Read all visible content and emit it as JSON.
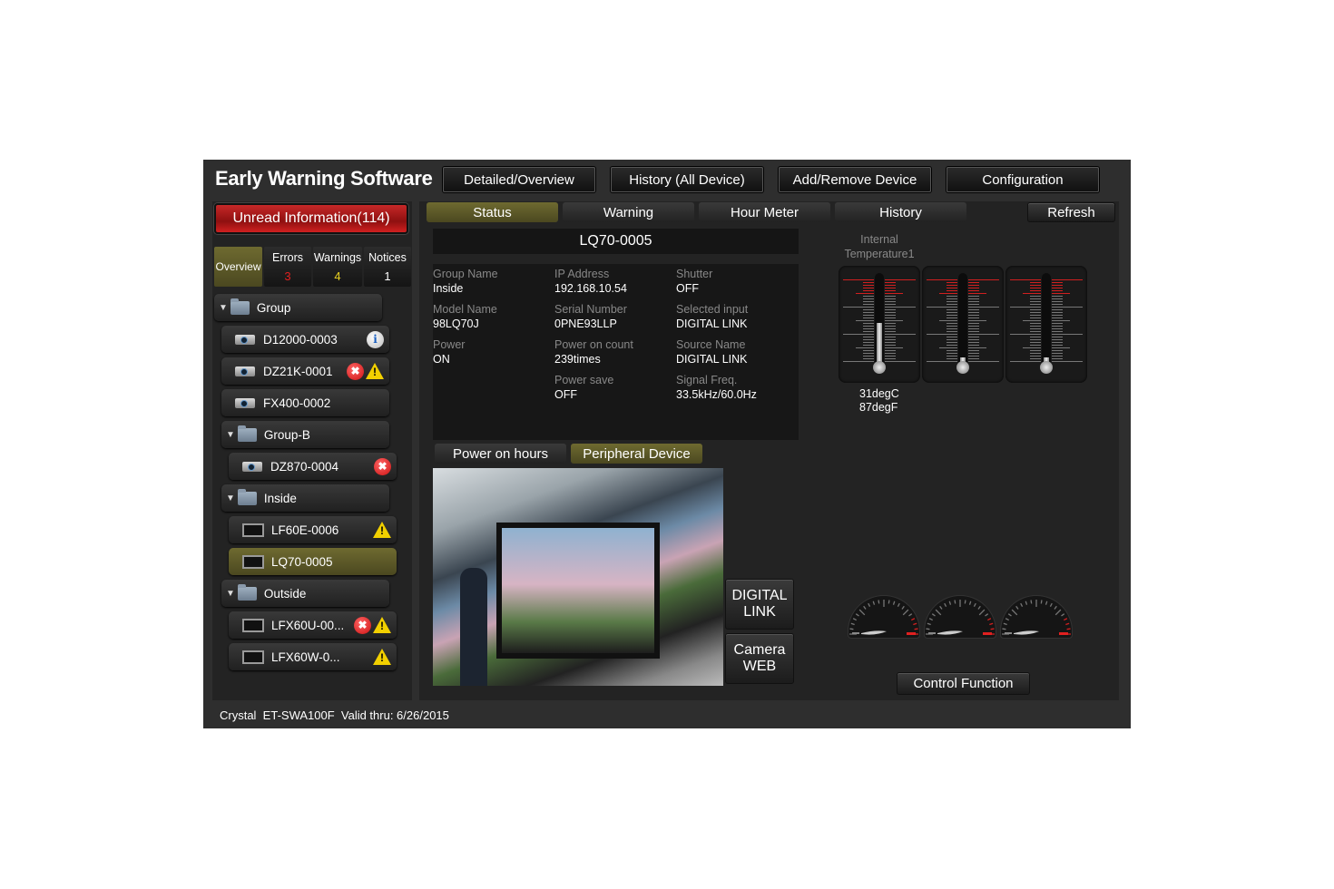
{
  "app": {
    "title": "Early Warning Software",
    "nav": [
      "Detailed/Overview",
      "History (All Device)",
      "Add/Remove Device",
      "Configuration"
    ],
    "footer": "Crystal  ET-SWA100F  Valid thru: 6/26/2015"
  },
  "sidebar": {
    "unread": "Unread Information(114)",
    "filters": [
      {
        "label": "Overview",
        "count": ""
      },
      {
        "label": "Errors",
        "count": "3",
        "color": "#e02020"
      },
      {
        "label": "Warnings",
        "count": "4",
        "color": "#e8d020"
      },
      {
        "label": "Notices",
        "count": "1",
        "color": "#ffffff"
      }
    ],
    "tree": [
      {
        "label": "Group",
        "type": "folder",
        "level": 0
      },
      {
        "label": "D12000-0003",
        "type": "projector",
        "level": 1,
        "icons": [
          "info"
        ]
      },
      {
        "label": "DZ21K-0001",
        "type": "projector",
        "level": 1,
        "icons": [
          "error",
          "warning"
        ]
      },
      {
        "label": "FX400-0002",
        "type": "projector",
        "level": 1,
        "icons": []
      },
      {
        "label": "Group-B",
        "type": "folder",
        "level": 1
      },
      {
        "label": "DZ870-0004",
        "type": "projector",
        "level": 2,
        "icons": [
          "error"
        ]
      },
      {
        "label": "Inside",
        "type": "folder",
        "level": 1
      },
      {
        "label": "LF60E-0006",
        "type": "display",
        "level": 2,
        "icons": [
          "warning"
        ]
      },
      {
        "label": "LQ70-0005",
        "type": "display",
        "level": 2,
        "icons": [],
        "selected": true
      },
      {
        "label": "Outside",
        "type": "folder",
        "level": 1
      },
      {
        "label": "LFX60U-00...",
        "type": "display",
        "level": 2,
        "icons": [
          "error",
          "warning"
        ]
      },
      {
        "label": "LFX60W-0...",
        "type": "display",
        "level": 2,
        "icons": [
          "warning"
        ]
      }
    ]
  },
  "main": {
    "tabs": [
      "Status",
      "Warning",
      "Hour Meter",
      "History"
    ],
    "active_tab": "Status",
    "refresh": "Refresh",
    "device": "LQ70-0005",
    "fields": [
      {
        "label": "Group Name",
        "value": "Inside"
      },
      {
        "label": "IP Address",
        "value": "192.168.10.54"
      },
      {
        "label": "Shutter",
        "value": "OFF"
      },
      {
        "label": "Model Name",
        "value": "98LQ70J"
      },
      {
        "label": "Serial Number",
        "value": "0PNE93LLP"
      },
      {
        "label": "Selected input",
        "value": "DIGITAL LINK"
      },
      {
        "label": "Power",
        "value": "ON"
      },
      {
        "label": "Power on count",
        "value": "239times"
      },
      {
        "label": "Source Name",
        "value": "DIGITAL LINK"
      },
      {
        "label": "",
        "value": ""
      },
      {
        "label": "Power save",
        "value": "OFF"
      },
      {
        "label": "Signal Freq.",
        "value": "33.5kHz/60.0Hz"
      }
    ],
    "subtabs": [
      "Power on hours",
      "Peripheral Device"
    ],
    "active_subtab": "Peripheral Device",
    "side_buttons": [
      "DIGITAL\nLINK",
      "Camera\nWEB"
    ],
    "temp_label": "Internal\nTemperature1",
    "temp_c": "31degC",
    "temp_f": "87degF",
    "thermometer_levels": [
      0.45,
      0.05,
      0.05
    ],
    "control": "Control Function"
  }
}
